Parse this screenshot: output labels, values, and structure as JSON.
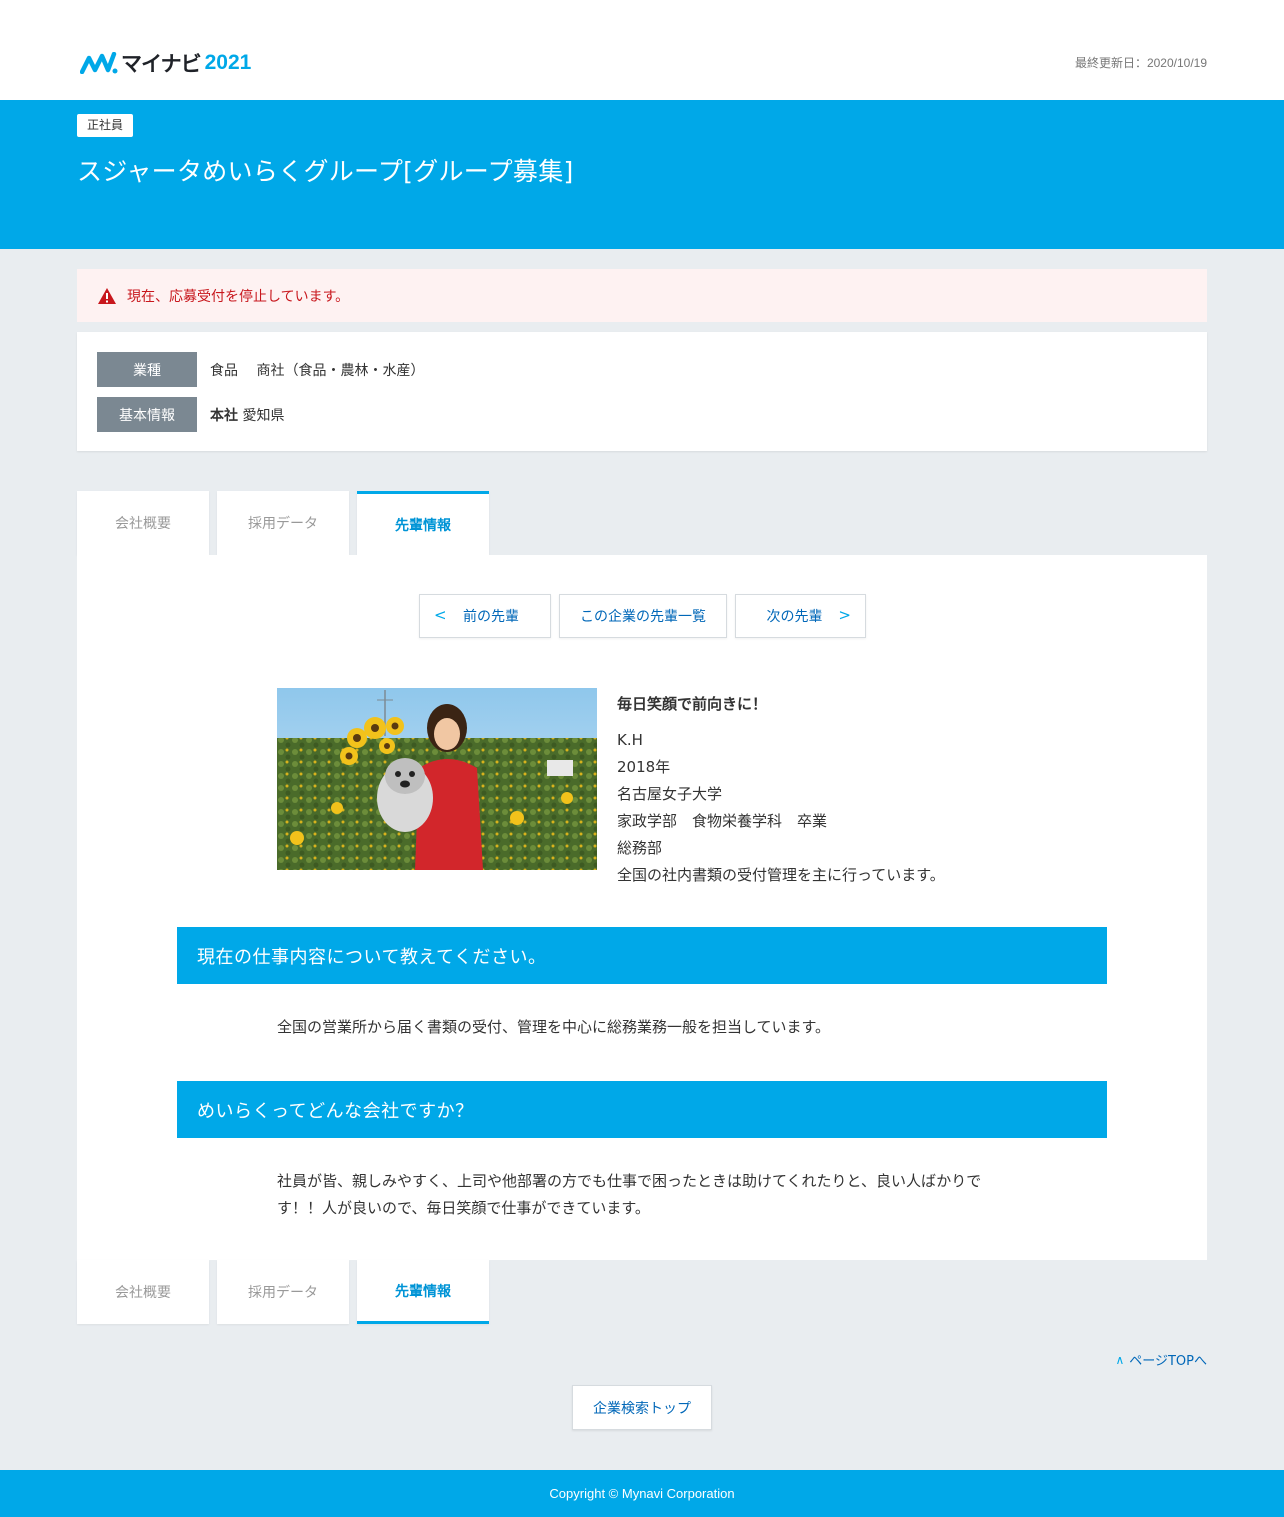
{
  "header": {
    "logo_kana": "マイナビ",
    "logo_year": "2021",
    "last_updated": "最終更新日：2020/10/19"
  },
  "hero": {
    "employment_badge": "正社員",
    "company_title": "スジャータめいらくグループ[グループ募集]"
  },
  "alert": {
    "message": "現在、応募受付を停止しています。"
  },
  "info": {
    "industry_label": "業種",
    "industry_value": "食品　 商社（食品・農林・水産）",
    "basic_label": "基本情報",
    "hq_label": "本社",
    "hq_value": "愛知県"
  },
  "tabs": [
    {
      "label": "会社概要"
    },
    {
      "label": "採用データ"
    },
    {
      "label": "先輩情報"
    }
  ],
  "senior_nav": {
    "prev": "前の先輩",
    "list": "この企業の先輩一覧",
    "next": "次の先輩"
  },
  "profile": {
    "catchphrase": "毎日笑顔で前向きに！",
    "initials": "K.H",
    "year": "2018年",
    "university": "名古屋女子大学",
    "faculty": "家政学部　食物栄養学科　卒業",
    "department": "総務部",
    "duty": "全国の社内書類の受付管理を主に行っています。"
  },
  "qa": [
    {
      "question": "現在の仕事内容について教えてください。",
      "answer": "全国の営業所から届く書類の受付、管理を中心に総務業務一般を担当しています。"
    },
    {
      "question": "めいらくってどんな会社ですか？",
      "answer": "社員が皆、親しみやすく、上司や他部署の方でも仕事で困ったときは助けてくれたりと、良い人ばかりです！！人が良いので、毎日笑顔で仕事ができています。"
    }
  ],
  "page_top": "ページTOPへ",
  "search_top": "企業検索トップ",
  "footer": {
    "copyright": "Copyright © Mynavi Corporation"
  },
  "icons": {
    "logo_mark": "mynavi-logo-icon",
    "alert": "warning-triangle-icon",
    "prev": "chevron-left-icon",
    "next": "chevron-right-icon",
    "page_top": "chevron-up-icon"
  },
  "colors": {
    "brand_blue": "#00a8e8",
    "alert_red": "#c8171d",
    "alert_bg": "#fef2f2",
    "label_gray": "#7b8892",
    "link_blue": "#0067b8"
  }
}
